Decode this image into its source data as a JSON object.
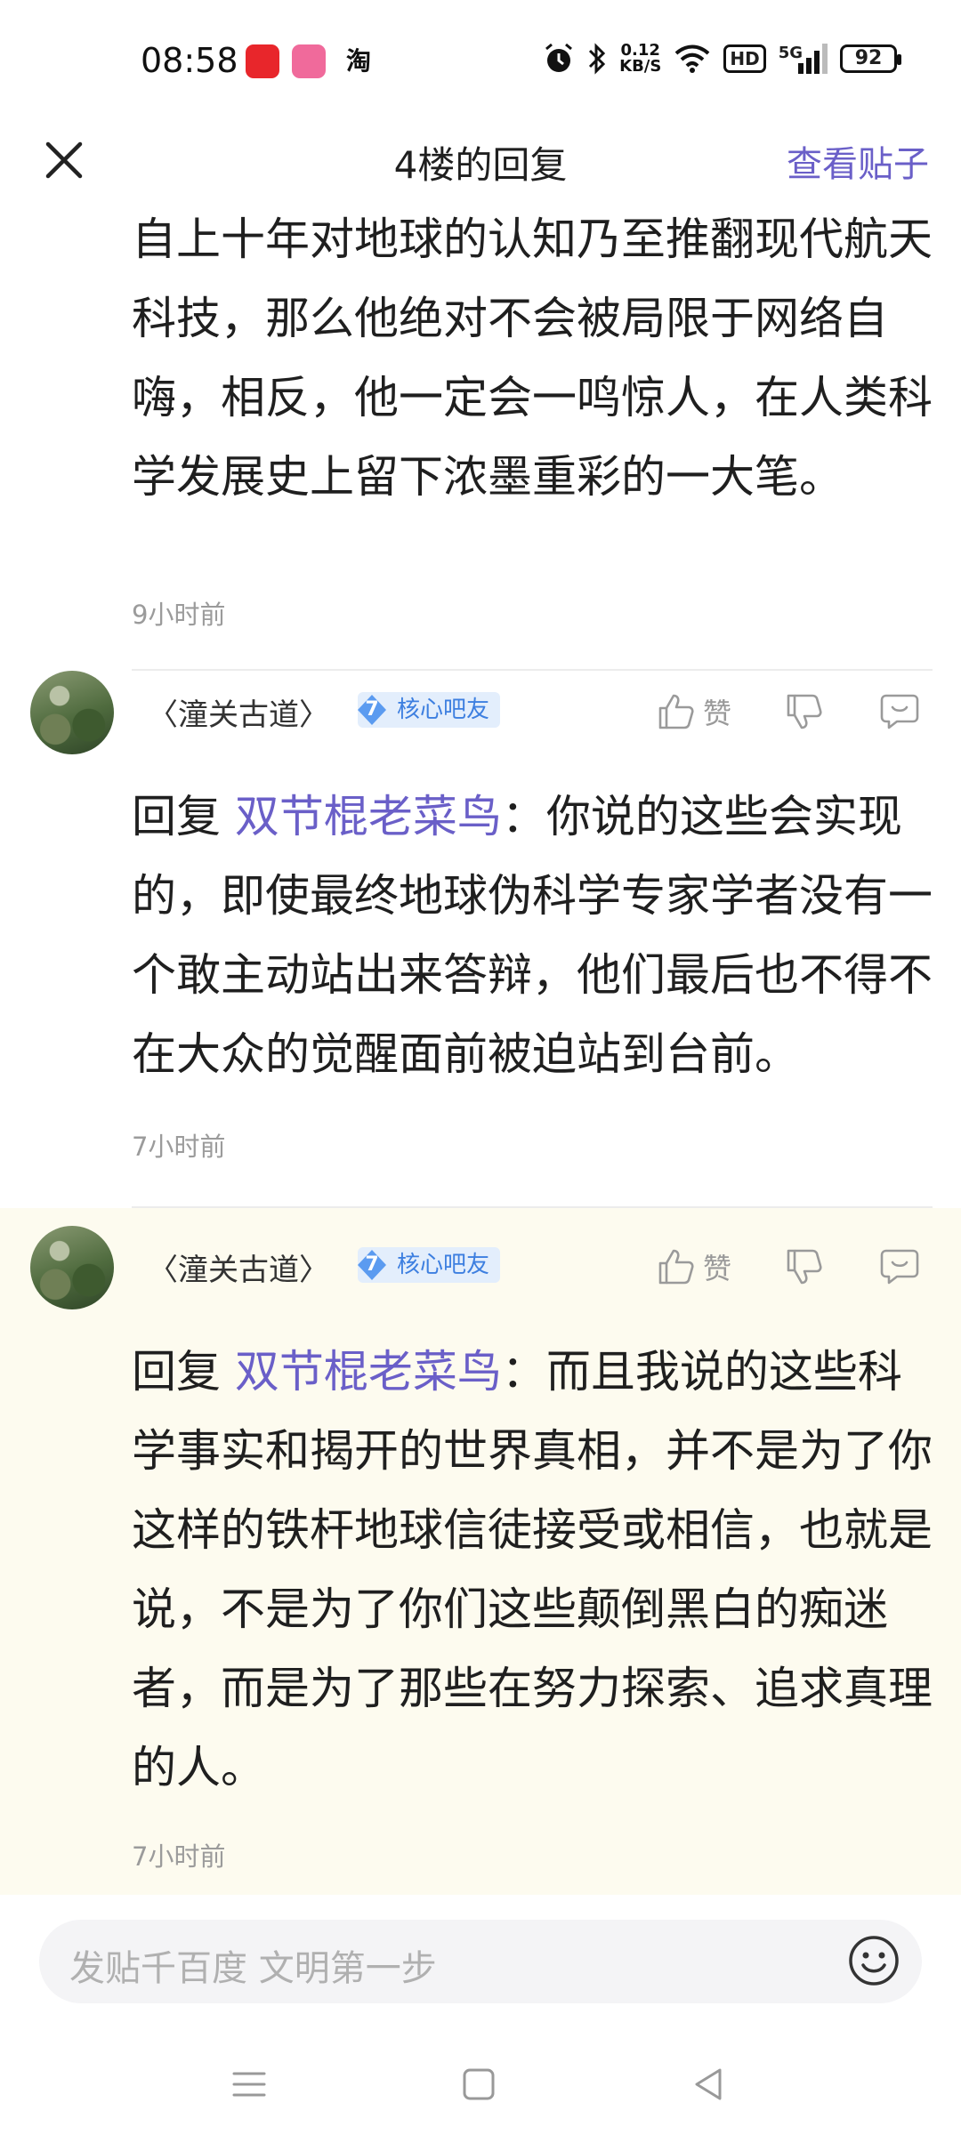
{
  "status_bar": {
    "time": "08:58",
    "app_icons": [
      "xiaohongshu-icon",
      "bilibili-icon",
      "taobao-icon"
    ],
    "taobao_glyph": "淘",
    "net_speed_value": "0.12",
    "net_speed_unit": "KB/S",
    "hd": "HD",
    "network": "5G",
    "battery": "92"
  },
  "header": {
    "title": "4楼的回复",
    "view_post": "查看贴子"
  },
  "partial_post": {
    "text": "自上十年对地球的认知乃至推翻现代航天科技，那么他绝对不会被局限于网络自嗨，相反，他一定会一鸣惊人，在人类科学发展史上留下浓墨重彩的一大笔。",
    "time": "9小时前"
  },
  "replies": [
    {
      "username": "〈潼关古道〉",
      "badge_level": "7",
      "badge_label": "核心吧友",
      "like_label": "赞",
      "prefix": "回复 ",
      "mention": "双节棍老菜鸟",
      "text": "：你说的这些会实现的，即使最终地球伪科学专家学者没有一个敢主动站出来答辩，他们最后也不得不在大众的觉醒面前被迫站到台前。",
      "time": "7小时前"
    },
    {
      "username": "〈潼关古道〉",
      "badge_level": "7",
      "badge_label": "核心吧友",
      "like_label": "赞",
      "prefix": "回复 ",
      "mention": "双节棍老菜鸟",
      "text": "：而且我说的这些科学事实和揭开的世界真相，并不是为了你这样的铁杆地球信徒接受或相信，也就是说，不是为了你们这些颠倒黑白的痴迷者，而是为了那些在努力探索、追求真理的人。",
      "time": "7小时前"
    }
  ],
  "composer": {
    "placeholder": "发贴千百度 文明第一步"
  },
  "colors": {
    "accent": "#6a5fc8",
    "badge_blue": "#3d7fe0",
    "highlight_bg": "#fdfbef"
  }
}
